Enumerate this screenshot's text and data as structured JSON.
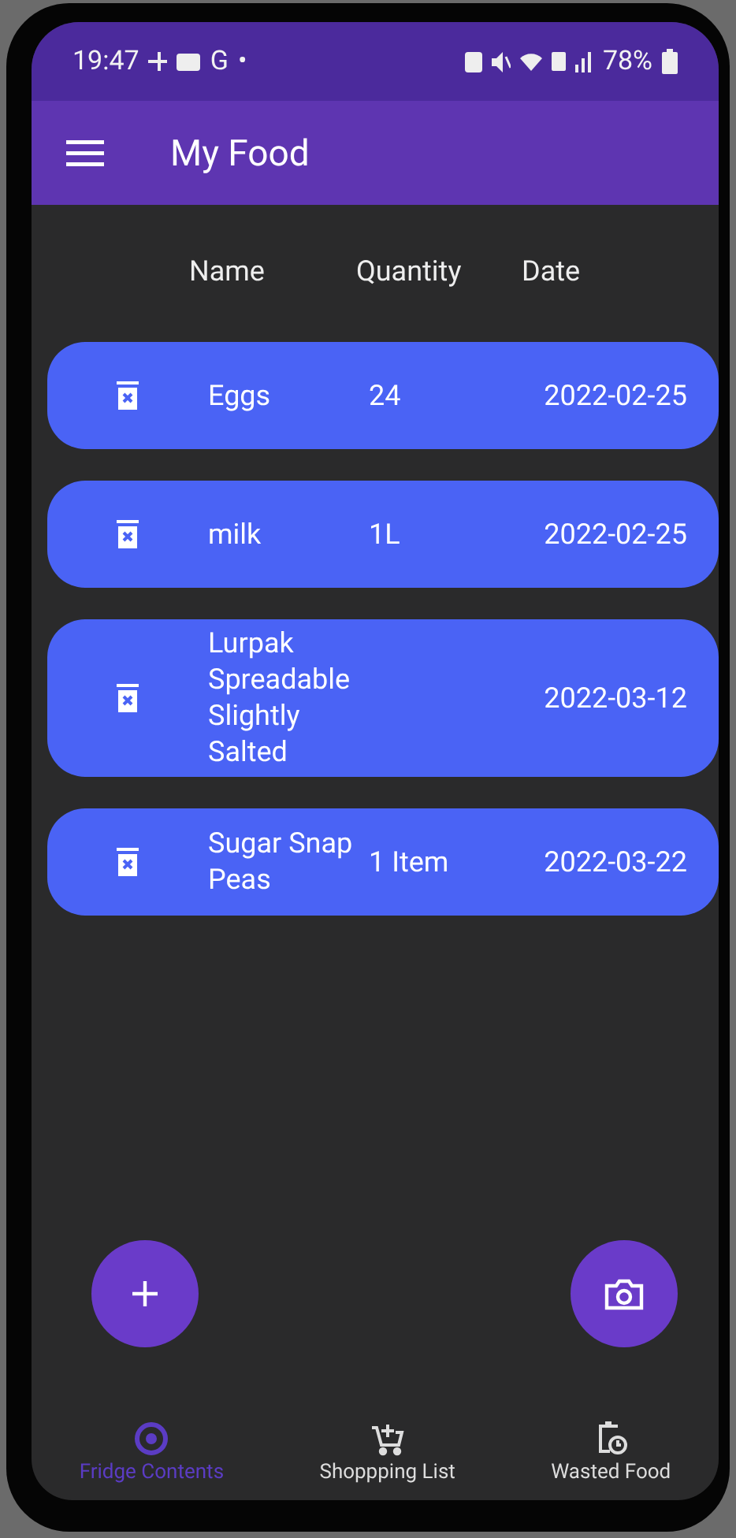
{
  "status_bar": {
    "time": "19:47",
    "network": "G",
    "dot": "•",
    "battery": "78%"
  },
  "app_bar": {
    "title": "My Food"
  },
  "table": {
    "columns": [
      "Name",
      "Quantity",
      "Date"
    ],
    "rows": [
      {
        "name": "Eggs",
        "quantity": "24",
        "date": "2022-02-25"
      },
      {
        "name": "milk",
        "quantity": "1L",
        "date": "2022-02-25"
      },
      {
        "name": "Lurpak Spreadable Slightly Salted",
        "date": "2022-03-12"
      },
      {
        "name": "Sugar Snap Peas",
        "quantity": "1 Item",
        "date": "2022-03-22"
      }
    ]
  },
  "fabs": [
    {
      "kind": "add"
    },
    {
      "kind": "camera"
    }
  ],
  "bottom_nav": [
    {
      "kind": "fridge",
      "label": "Fridge Contents",
      "selected": true
    },
    {
      "kind": "cart",
      "label": "Shoppping List",
      "selected": false
    },
    {
      "kind": "waste",
      "label": "Wasted Food",
      "selected": false
    }
  ]
}
